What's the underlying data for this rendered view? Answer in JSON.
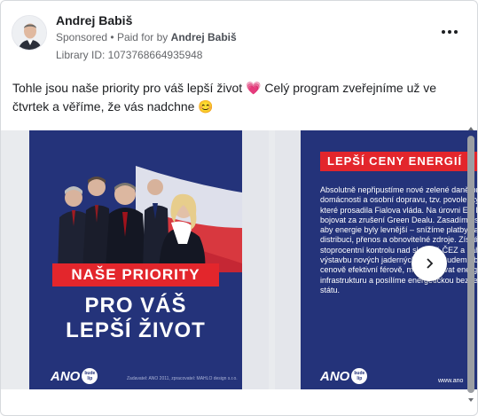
{
  "advertiser": {
    "name": "Andrej Babiš",
    "sponsored": "Sponsored",
    "separator": "•",
    "paid_prefix": "Paid for by",
    "paid_by": "Andrej Babiš",
    "library_id": "Library ID: 1073768664935948"
  },
  "post": {
    "text": "Tohle jsou naše priority pro váš lepší život 💗 Celý program zveřejníme už ve čtvrtek a věříme, že vás nadchne 😊"
  },
  "slide1": {
    "banner": "NAŠE PRIORITY",
    "line1": "PRO VÁŠ",
    "line2": "LEPŠÍ ŽIVOT",
    "footer": "Zadavatel: ANO 2011, zpracovatel: MAHLO design s.r.o.",
    "logo_text": "ANO",
    "logo_badge_top": "bude",
    "logo_badge_bottom": "líp"
  },
  "slide2": {
    "banner": "LEPŠÍ CENY ENERGIÍ",
    "text": "Absolutně nepřipustíme nové zelené daně pro domácnosti a osobní dopravu, tzv. povolenky ETS2, které prosadila Fialova vláda. Na úrovni EU budeme bojovat za zrušení Green Dealu. Zasadíme se o to, aby energie byly levnější – snížíme platby za distribuci, přenos a obnovitelné zdroje. Získáme stoprocentní kontrolu nad skupině ČEZ a zahájíme výstavbu nových jaderných bloků. Budeme budovat cenově efektivní férově, modernizovat energetickou infrastrukturu a posílíme energetickou bezpečnost státu.",
    "url": "www.ano",
    "logo_text": "ANO",
    "logo_badge_top": "bude",
    "logo_badge_bottom": "líp"
  },
  "icons": {
    "more": "more-horizontal-icon",
    "next": "chevron-right-icon",
    "scroll_up": "scroll-up-arrow-icon",
    "scroll_down": "scroll-down-arrow-icon"
  },
  "colors": {
    "navy": "#24337a",
    "red": "#e3262c",
    "scrollbar": "#9b9ea3"
  }
}
